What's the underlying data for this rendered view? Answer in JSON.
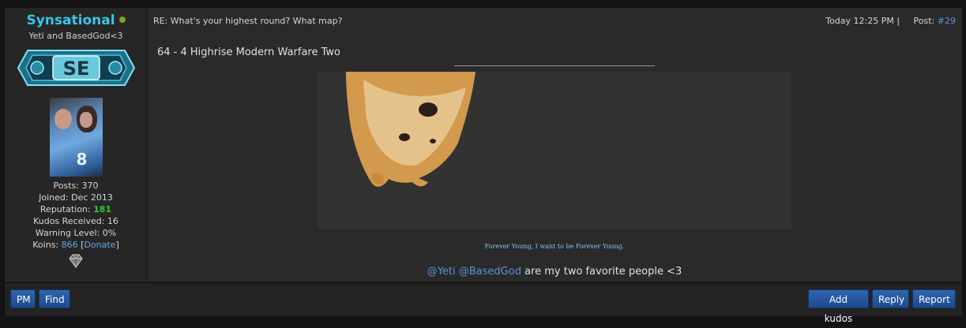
{
  "author": {
    "username": "Synsational",
    "usertitle": "Yeti and BasedGod<3",
    "badge_text": "SE",
    "stats": {
      "posts_label": "Posts:",
      "posts": "370",
      "joined_label": "Joined:",
      "joined": "Dec 2013",
      "reputation_label": "Reputation:",
      "reputation": "181",
      "kudos_label": "Kudos Received:",
      "kudos": "16",
      "warning_label": "Warning Level:",
      "warning": "0%",
      "koins_label": "Koins:",
      "koins": "866",
      "donate": "Donate"
    }
  },
  "post": {
    "subject": "RE: What's your highest round? What map?",
    "date": "Today 12:25 PM",
    "post_label": "Post:",
    "post_number": "#29",
    "message": "64 - 4 Highrise Modern Warfare Two",
    "signature_text": "Forever Young, I want to be Forever Young.",
    "mention1": "@Yeti",
    "mention2": "@BasedGod",
    "mention_rest": "are my two favorite people <3"
  },
  "footer": {
    "pm": "PM",
    "find": "Find",
    "add_kudos": "Add kudos",
    "reply": "Reply",
    "report": "Report"
  },
  "colors": {
    "username": "#35c7e8",
    "reputation": "#2ecc2e",
    "link": "#5b93d6",
    "button": "#2f64b0"
  }
}
